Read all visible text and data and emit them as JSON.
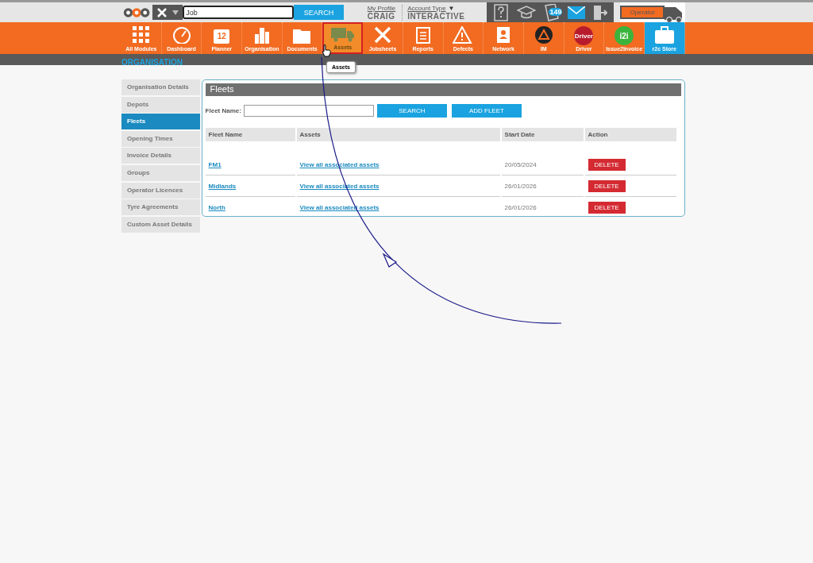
{
  "header": {
    "search": {
      "value": "Job",
      "button": "SEARCH"
    },
    "profile": {
      "link": "My Profile",
      "name": "CRAIG"
    },
    "account": {
      "link": "Account Type",
      "caret": "▼",
      "value": "INTERACTIVE"
    },
    "notification_count": "149",
    "operator": "Operator"
  },
  "modules": [
    {
      "label": "All Modules",
      "selected": false,
      "kind": "module"
    },
    {
      "label": "Dashboard",
      "selected": false,
      "kind": "module"
    },
    {
      "label": "Planner",
      "selected": false,
      "kind": "module",
      "icon_text": "12"
    },
    {
      "label": "Organisation",
      "selected": false,
      "kind": "module"
    },
    {
      "label": "Documents",
      "selected": false,
      "kind": "module"
    },
    {
      "label": "Assets",
      "selected": true,
      "kind": "module"
    },
    {
      "label": "Jobsheets",
      "selected": false,
      "kind": "module"
    },
    {
      "label": "Reports",
      "selected": false,
      "kind": "module"
    },
    {
      "label": "Defects",
      "selected": false,
      "kind": "module"
    },
    {
      "label": "Network",
      "selected": false,
      "kind": "module"
    },
    {
      "label": "IM",
      "selected": false,
      "kind": "module"
    },
    {
      "label": "Driver",
      "selected": false,
      "kind": "module",
      "icon_text": "Driver"
    },
    {
      "label": "Issue2Invoice",
      "selected": false,
      "kind": "module",
      "icon_text": "i2i"
    },
    {
      "label": "r2c Store",
      "selected": false,
      "kind": "store"
    }
  ],
  "tooltip": "Assets",
  "section_title": "ORGANISATION",
  "sidebar": {
    "items": [
      {
        "label": "Organisation Details",
        "selected": false
      },
      {
        "label": "Depots",
        "selected": false
      },
      {
        "label": "Fleets",
        "selected": true
      },
      {
        "label": "Opening Times",
        "selected": false
      },
      {
        "label": "Invoice Details",
        "selected": false
      },
      {
        "label": "Groups",
        "selected": false
      },
      {
        "label": "Operator Licences",
        "selected": false
      },
      {
        "label": "Tyre Agreements",
        "selected": false
      },
      {
        "label": "Custom Asset Details",
        "selected": false
      }
    ]
  },
  "panel": {
    "title": "Fleets",
    "filter_label": "Fleet Name:",
    "search_button": "SEARCH",
    "add_button": "ADD FLEET",
    "table": {
      "columns": [
        "Fleet Name",
        "Assets",
        "Start Date",
        "Action"
      ],
      "rows": [
        {
          "name": "FM1",
          "assets": "View all associated assets",
          "start_date": "20/05/2024",
          "action": "DELETE"
        },
        {
          "name": "Midlands",
          "assets": "View all associated assets",
          "start_date": "26/01/2026",
          "action": "DELETE"
        },
        {
          "name": "North",
          "assets": "View all associated assets",
          "start_date": "26/01/2026",
          "action": "DELETE"
        }
      ]
    }
  }
}
